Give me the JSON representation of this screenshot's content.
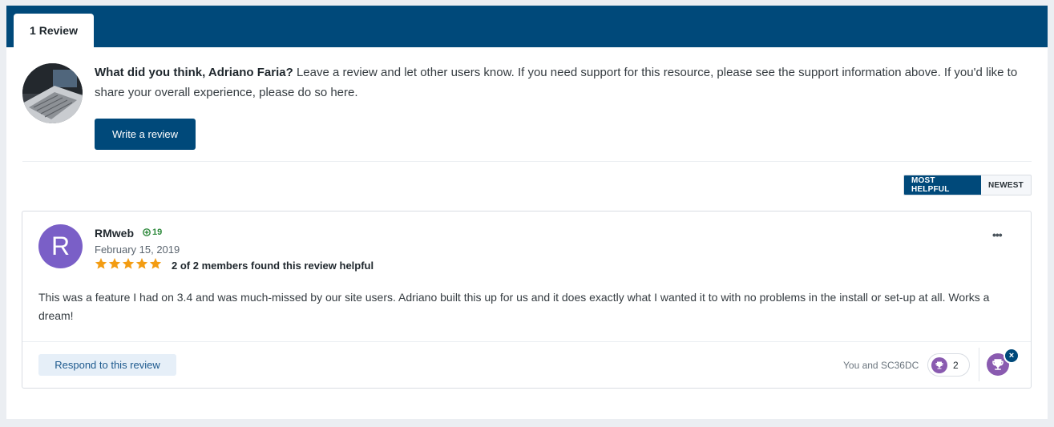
{
  "tabs": {
    "reviews_tab_label": "1 Review"
  },
  "prompt": {
    "question": "What did you think, Adriano Faria?",
    "message": " Leave a review and let other users know. If you need support for this resource, please see the support information above. If you'd like to share your overall experience, please do so here.",
    "write_button": "Write a review"
  },
  "sort": {
    "most_helpful": "MOST HELPFUL",
    "newest": "NEWEST"
  },
  "review": {
    "avatar_letter": "R",
    "author": "RMweb",
    "reputation": "19",
    "date": "February 15, 2019",
    "rating": 5,
    "helpful": "2 of 2 members found this review helpful",
    "menu_icon": "•••",
    "body": "This was a feature I had on 3.4 and was much-missed by our site users. Adriano built this up for us and it does exactly what I wanted it to with no problems in the install or set-up at all. Works a dream!",
    "respond_button": "Respond to this review",
    "reaction_users": "You and SC36DC",
    "reaction_count": "2",
    "close_icon": "×"
  },
  "colors": {
    "brand": "#00497a",
    "star": "#f39c12",
    "avatar": "#7a5fc7",
    "reaction": "#8a5bb0",
    "reputation": "#2f8a3d"
  }
}
